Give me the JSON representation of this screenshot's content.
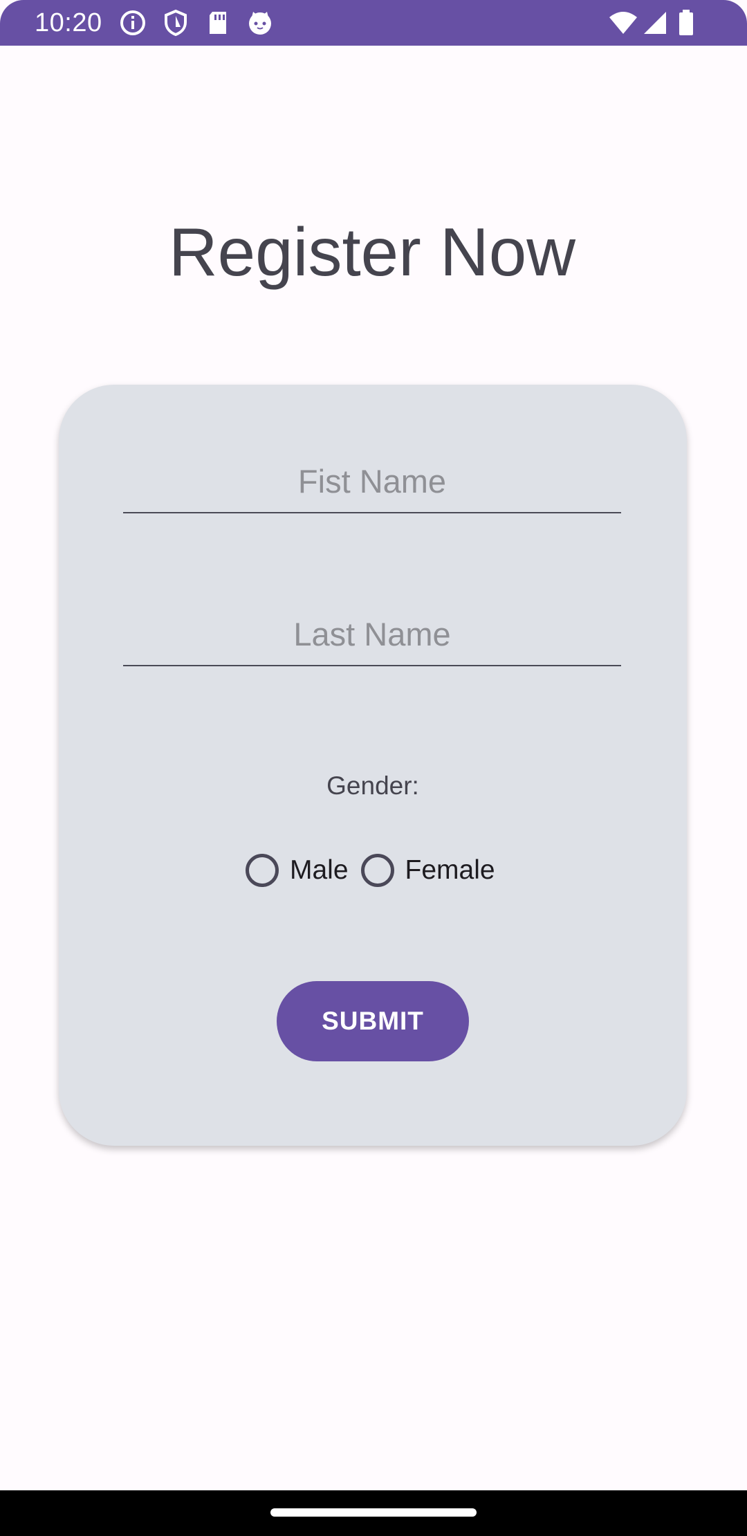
{
  "status_bar": {
    "time": "10:20",
    "background_color": "#6750a4",
    "left_icons": [
      "info-icon",
      "shield-icon",
      "sd-card-icon",
      "cat-icon"
    ],
    "right_icons": [
      "wifi-icon",
      "cellular-icon",
      "battery-icon"
    ]
  },
  "page": {
    "title": "Register Now"
  },
  "form": {
    "first_name": {
      "value": "",
      "placeholder": "Fist Name"
    },
    "last_name": {
      "value": "",
      "placeholder": "Last Name"
    },
    "gender_label": "Gender:",
    "gender_options": [
      {
        "label": "Male",
        "selected": false
      },
      {
        "label": "Female",
        "selected": false
      }
    ],
    "submit_label": "SUBMIT",
    "accent_color": "#6750a4",
    "card_color": "#dee1e7"
  },
  "nav_bar": {
    "handle": "home-handle"
  }
}
